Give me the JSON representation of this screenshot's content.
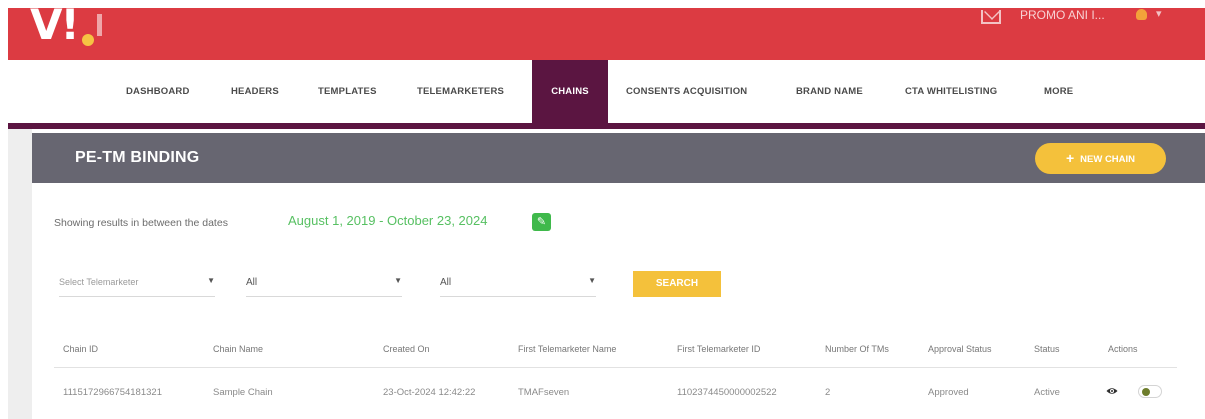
{
  "header": {
    "user_name": "PROMO ANI I...",
    "icons": [
      "mail-icon",
      "user-icon",
      "chevron-down-icon"
    ]
  },
  "nav": {
    "items": [
      {
        "label": "DASHBOARD",
        "active": false
      },
      {
        "label": "HEADERS",
        "active": false
      },
      {
        "label": "TEMPLATES",
        "active": false
      },
      {
        "label": "TELEMARKETERS",
        "active": false
      },
      {
        "label": "CHAINS",
        "active": true
      },
      {
        "label": "CONSENTS ACQUISITION",
        "active": false
      },
      {
        "label": "BRAND NAME",
        "active": false
      },
      {
        "label": "CTA WHITELISTING",
        "active": false
      },
      {
        "label": "MORE",
        "active": false
      }
    ]
  },
  "card": {
    "title": "PE-TM BINDING",
    "new_chain_label": "NEW CHAIN"
  },
  "date_range": {
    "label": "Showing results in between the dates",
    "value": "August 1, 2019 - October 23, 2024"
  },
  "filters": {
    "telemarketer_placeholder": "Select Telemarketer",
    "filter2_value": "All",
    "filter3_value": "All",
    "search_label": "SEARCH"
  },
  "table": {
    "columns": [
      "Chain ID",
      "Chain Name",
      "Created On",
      "First Telemarketer Name",
      "First Telemarketer ID",
      "Number Of TMs",
      "Approval Status",
      "Status",
      "Actions"
    ],
    "rows": [
      [
        "1115172966754181321",
        "Sample Chain",
        "23-Oct-2024 12:42:22",
        "TMAFseven",
        "1102374450000002522",
        "2",
        "Approved",
        "Active"
      ]
    ]
  },
  "colors": {
    "brand_red": "#dc3b42",
    "nav_active": "#5b1541",
    "header_gray": "#676671",
    "accent_yellow": "#f4c13b",
    "date_green": "#57c062"
  }
}
